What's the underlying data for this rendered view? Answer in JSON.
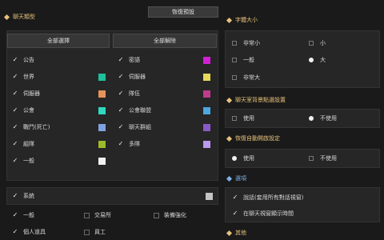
{
  "left": {
    "section_title": "聊天類型",
    "reset_label": "恢復預設",
    "select_all": "全部選擇",
    "clear_all": "全部解除",
    "channels_col1": [
      {
        "label": "公告"
      },
      {
        "label": "世界"
      },
      {
        "label": "伺服器"
      },
      {
        "label": "公會"
      },
      {
        "label": "戰鬥(死亡)"
      },
      {
        "label": "組隊"
      },
      {
        "label": "一般"
      }
    ],
    "channels_col2": [
      {
        "label": "密語"
      },
      {
        "label": "伺服器"
      },
      {
        "label": "隊伍"
      },
      {
        "label": "公會聯盟"
      },
      {
        "label": "聊天群組"
      },
      {
        "label": "多隊"
      }
    ],
    "swatches_col1": [
      "#1fbf9a",
      "#e6935a",
      "#2fd9c0",
      "#7fa3e0",
      "#9bbb2a",
      "#f2f2f2"
    ],
    "swatches_col2": [
      "#d11fd4",
      "#e8d85a",
      "#bf3c8c",
      "#4ea8e0",
      "#8a59c8",
      "#b99aee"
    ],
    "system_label": "系統",
    "system_swatch": "#c4c4c4",
    "bottom": [
      {
        "label": "一般",
        "checked": true
      },
      {
        "label": "交易所",
        "checked": false
      },
      {
        "label": "裝備強化",
        "checked": false
      },
      {
        "label": "個人道具",
        "checked": true
      },
      {
        "label": "員工",
        "checked": false
      }
    ]
  },
  "right": {
    "size_title": "字體大小",
    "size_options": [
      {
        "label": "非常小",
        "on": false
      },
      {
        "label": "小",
        "on": false
      },
      {
        "label": "一般",
        "on": false
      },
      {
        "label": "大",
        "on": true
      },
      {
        "label": "非常大",
        "on": false
      }
    ],
    "bubble_title": "聊天室背景點選設置",
    "bubble_use": "使用",
    "bubble_nouse": "不使用",
    "bubble_selected": "nouse",
    "effect_title": "恢復自動開啟設定",
    "effect_use": "使用",
    "effect_nouse": "不使用",
    "effect_selected": "use",
    "options_title": "選項",
    "options": [
      {
        "label": "說話(套用所有對話視窗)",
        "checked": true
      },
      {
        "label": "在聊天視窗顯示時間",
        "checked": true
      }
    ],
    "last_title": "其他"
  }
}
